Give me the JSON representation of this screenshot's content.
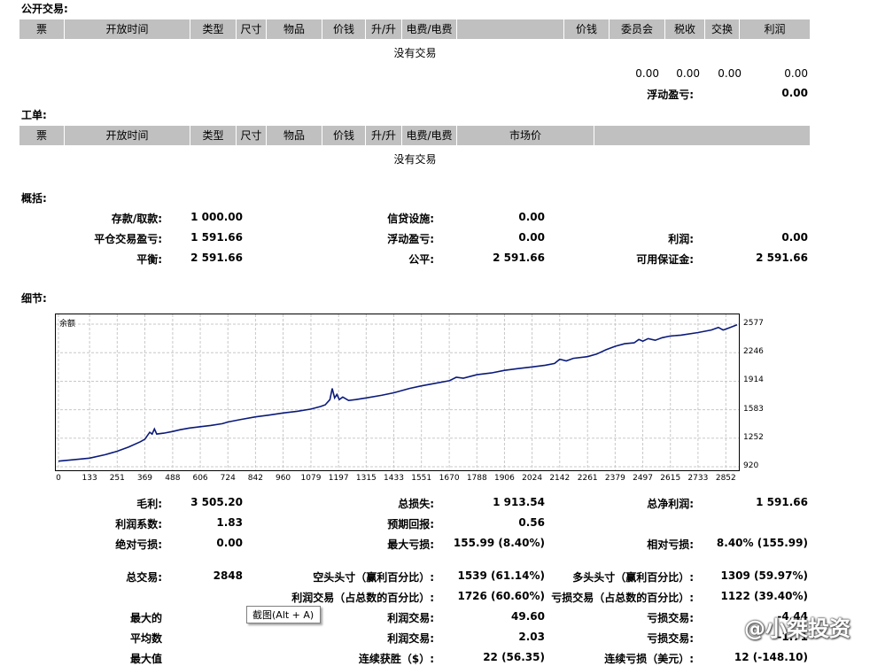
{
  "sections": {
    "open_trades": "公开交易:",
    "orders": "工单:",
    "summary": "概括:",
    "details": "细节:"
  },
  "open_header": [
    "票",
    "开放时间",
    "类型",
    "尺寸",
    "物品",
    "价钱",
    "升/升",
    "电费/电费",
    "",
    "价钱",
    "委员会",
    "税收",
    "交换",
    "利润"
  ],
  "orders_header": [
    "票",
    "开放时间",
    "类型",
    "尺寸",
    "物品",
    "价钱",
    "升/升",
    "电费/电费",
    "市场价",
    ""
  ],
  "no_trades": "没有交易",
  "open_totals": [
    "0.00",
    "0.00",
    "0.00",
    "0.00"
  ],
  "floating_label": "浮动盈亏:",
  "floating_value": "0.00",
  "summary_rows": [
    [
      {
        "l": "存款/取款:",
        "v": "1 000.00"
      },
      {
        "l": "信贷设施:",
        "v": "0.00"
      },
      {
        "l": "",
        "v": ""
      }
    ],
    [
      {
        "l": "平仓交易盈亏:",
        "v": "1 591.66"
      },
      {
        "l": "浮动盈亏:",
        "v": "0.00"
      },
      {
        "l": "利润:",
        "v": "0.00"
      }
    ],
    [
      {
        "l": "平衡:",
        "v": "2 591.66"
      },
      {
        "l": "公平:",
        "v": "2 591.66"
      },
      {
        "l": "可用保证金:",
        "v": "2 591.66"
      }
    ]
  ],
  "chart_data": {
    "type": "line",
    "title": "余额",
    "x_ticks": [
      "0",
      "133",
      "251",
      "369",
      "488",
      "606",
      "724",
      "842",
      "960",
      "1079",
      "1197",
      "1315",
      "1433",
      "1551",
      "1670",
      "1788",
      "1906",
      "2024",
      "2142",
      "2261",
      "2379",
      "2497",
      "2615",
      "2733",
      "2852"
    ],
    "y_ticks": [
      "2577",
      "2246",
      "1914",
      "1583",
      "1252",
      "920"
    ],
    "xlim": [
      0,
      2900
    ],
    "ylim": [
      920,
      2660
    ],
    "grid": true,
    "series": [
      {
        "color": "#0a1a7a",
        "points": [
          [
            0,
            985
          ],
          [
            60,
            1000
          ],
          [
            133,
            1020
          ],
          [
            200,
            1060
          ],
          [
            251,
            1100
          ],
          [
            300,
            1150
          ],
          [
            350,
            1210
          ],
          [
            369,
            1240
          ],
          [
            390,
            1320
          ],
          [
            400,
            1300
          ],
          [
            410,
            1360
          ],
          [
            420,
            1300
          ],
          [
            450,
            1310
          ],
          [
            488,
            1330
          ],
          [
            520,
            1350
          ],
          [
            560,
            1370
          ],
          [
            606,
            1385
          ],
          [
            650,
            1400
          ],
          [
            700,
            1420
          ],
          [
            724,
            1440
          ],
          [
            780,
            1470
          ],
          [
            842,
            1500
          ],
          [
            900,
            1520
          ],
          [
            960,
            1545
          ],
          [
            1020,
            1565
          ],
          [
            1079,
            1590
          ],
          [
            1120,
            1620
          ],
          [
            1140,
            1640
          ],
          [
            1160,
            1700
          ],
          [
            1170,
            1830
          ],
          [
            1180,
            1720
          ],
          [
            1190,
            1760
          ],
          [
            1200,
            1700
          ],
          [
            1215,
            1730
          ],
          [
            1240,
            1690
          ],
          [
            1270,
            1700
          ],
          [
            1315,
            1720
          ],
          [
            1380,
            1750
          ],
          [
            1433,
            1780
          ],
          [
            1500,
            1830
          ],
          [
            1551,
            1860
          ],
          [
            1610,
            1890
          ],
          [
            1670,
            1920
          ],
          [
            1700,
            1960
          ],
          [
            1730,
            1950
          ],
          [
            1788,
            1990
          ],
          [
            1850,
            2010
          ],
          [
            1906,
            2040
          ],
          [
            1960,
            2060
          ],
          [
            2024,
            2080
          ],
          [
            2080,
            2100
          ],
          [
            2120,
            2120
          ],
          [
            2142,
            2170
          ],
          [
            2170,
            2150
          ],
          [
            2200,
            2180
          ],
          [
            2261,
            2200
          ],
          [
            2300,
            2230
          ],
          [
            2340,
            2280
          ],
          [
            2379,
            2320
          ],
          [
            2420,
            2350
          ],
          [
            2460,
            2360
          ],
          [
            2480,
            2400
          ],
          [
            2497,
            2380
          ],
          [
            2520,
            2410
          ],
          [
            2550,
            2390
          ],
          [
            2580,
            2420
          ],
          [
            2615,
            2440
          ],
          [
            2660,
            2450
          ],
          [
            2733,
            2480
          ],
          [
            2790,
            2510
          ],
          [
            2820,
            2540
          ],
          [
            2840,
            2510
          ],
          [
            2852,
            2520
          ],
          [
            2900,
            2570
          ]
        ]
      }
    ]
  },
  "stats_rows": [
    [
      {
        "l": "毛利:",
        "v": "3 505.20"
      },
      {
        "l": "总损失:",
        "v": "1 913.54"
      },
      {
        "l": "总净利润:",
        "v": "1 591.66"
      }
    ],
    [
      {
        "l": "利润系数:",
        "v": "1.83"
      },
      {
        "l": "预期回报:",
        "v": "0.56"
      },
      {
        "l": "",
        "v": ""
      }
    ],
    [
      {
        "l": "绝对亏损:",
        "v": "0.00"
      },
      {
        "l": "最大亏损:",
        "v": "155.99 (8.40%)"
      },
      {
        "l": "相对亏损:",
        "v": "8.40% (155.99)"
      }
    ],
    [
      {
        "l": "总交易:",
        "v": "2848"
      },
      {
        "l": "空头头寸（赢利百分比）:",
        "v": "1539 (61.14%)"
      },
      {
        "l": "多头头寸（赢利百分比）:",
        "v": "1309 (59.97%)"
      }
    ],
    [
      {
        "l": "",
        "v": ""
      },
      {
        "l": "利润交易（占总数的百分比）:",
        "v": "1726 (60.60%)"
      },
      {
        "l": "亏损交易（占总数的百分比）:",
        "v": "1122 (39.40%)"
      }
    ],
    [
      {
        "l": "最大的",
        "v": ""
      },
      {
        "l": "利润交易:",
        "v": "49.60"
      },
      {
        "l": "亏损交易:",
        "v": "-4.44"
      }
    ],
    [
      {
        "l": "平均数",
        "v": ""
      },
      {
        "l": "利润交易:",
        "v": "2.03"
      },
      {
        "l": "亏损交易:",
        "v": "-1.71"
      }
    ],
    [
      {
        "l": "最大值",
        "v": ""
      },
      {
        "l": "连续获胜（$）:",
        "v": "22 (56.35)"
      },
      {
        "l": "连续亏损（美元）:",
        "v": "12 (-148.10)"
      }
    ]
  ],
  "tooltip": "截图(Alt + A)",
  "watermark": "@小桀投资"
}
